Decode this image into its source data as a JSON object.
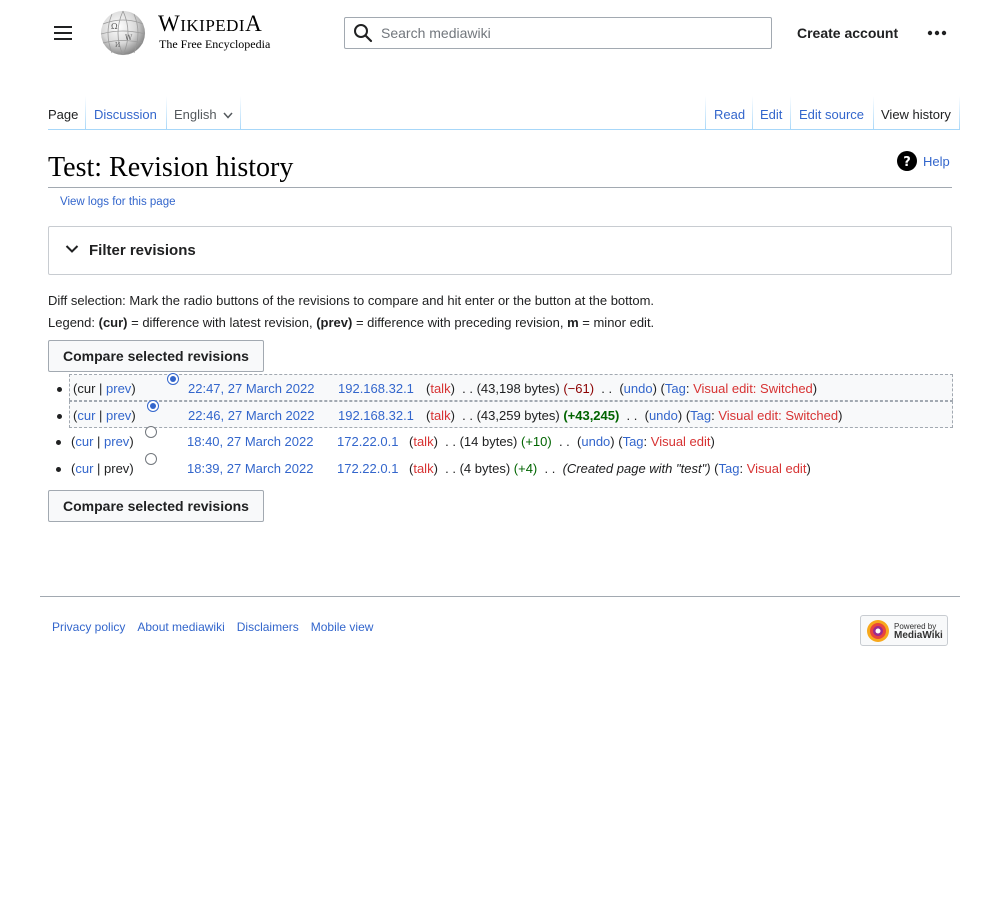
{
  "header": {
    "wordmark_first": "W",
    "wordmark_rest": "IKIPEDI",
    "wordmark_last": "A",
    "tagline": "The Free Encyclopedia",
    "search_placeholder": "Search mediawiki",
    "create_account": "Create account"
  },
  "tabs": {
    "left": [
      "Page",
      "Discussion",
      "English"
    ],
    "right": [
      "Read",
      "Edit",
      "Edit source",
      "View history"
    ]
  },
  "page": {
    "title": "Test: Revision history",
    "help": "Help",
    "view_logs": "View logs for this page",
    "filter_label": "Filter revisions",
    "diffsel_line": "Diff selection: Mark the radio buttons of the revisions to compare and hit enter or the button at the bottom.",
    "legend_prefix": "Legend: ",
    "legend_cur": "(cur)",
    "legend_cur_text": " = difference with latest revision, ",
    "legend_prev": "(prev)",
    "legend_prev_text": " = difference with preceding revision, ",
    "legend_m": "m",
    "legend_m_text": " = minor edit.",
    "compare_button": "Compare selected revisions"
  },
  "history": [
    {
      "cur": "cur",
      "prev": "prev",
      "date": "22:47, 27 March 2022",
      "user": "192.168.32.1",
      "talk": "talk",
      "bytes": "(43,198 bytes)",
      "diff": "(−61)",
      "undo": "undo",
      "tag_label": "Tag",
      "tag": "Visual edit: Switched"
    },
    {
      "cur": "cur",
      "prev": "prev",
      "date": "22:46, 27 March 2022",
      "user": "192.168.32.1",
      "talk": "talk",
      "bytes": "(43,259 bytes)",
      "diff": "(+43,245)",
      "undo": "undo",
      "tag_label": "Tag",
      "tag": "Visual edit: Switched"
    },
    {
      "cur": "cur",
      "prev": "prev",
      "date": "18:40, 27 March 2022",
      "user": "172.22.0.1",
      "talk": "talk",
      "bytes": "(14 bytes)",
      "diff": "(+10)",
      "undo": "undo",
      "tag_label": "Tag",
      "tag": "Visual edit"
    },
    {
      "cur": "cur",
      "prev": "prev",
      "date": "18:39, 27 March 2022",
      "user": "172.22.0.1",
      "talk": "talk",
      "bytes": "(4 bytes)",
      "diff": "(+4)",
      "comment": "(Created page with \"test\")",
      "tag_label": "Tag",
      "tag": "Visual edit"
    }
  ],
  "footer": {
    "links": [
      "Privacy policy",
      "About mediawiki",
      "Disclaimers",
      "Mobile view"
    ],
    "powered_line1": "Powered by",
    "powered_line2": "MediaWiki"
  },
  "colors": {
    "link": "#3366cc",
    "new_link": "#d73333",
    "positive": "#006400",
    "negative": "#8b0000"
  }
}
